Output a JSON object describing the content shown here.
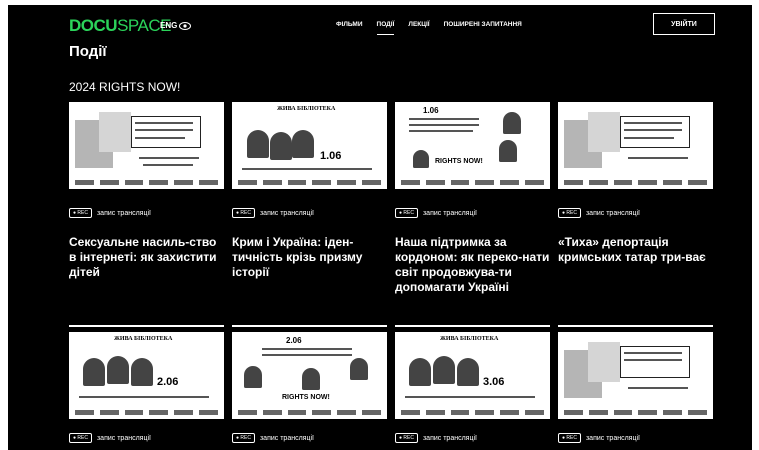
{
  "header": {
    "logo_bold": "DOCU",
    "logo_thin": "SPACE",
    "lang": "ENG",
    "nav": [
      "ФІЛЬМИ",
      "ПОДІЇ",
      "ЛЕКЦІЇ",
      "ПОШИРЕНІ ЗАПИТАННЯ"
    ],
    "login": "УВІЙТИ"
  },
  "page_title": "Події",
  "section_title": "2024 RIGHTS NOW!",
  "rec_badge": "● REC",
  "rec_label": "запис трансляції",
  "cards_row1": [
    {
      "title": "Сексуальне насиль-ство в інтернеті: як захистити дітей"
    },
    {
      "title": "Крим і Україна: іден-тичність крізь призму історії"
    },
    {
      "title": "Наша підтримка за кордоном: як переко-нати світ продовжува-ти допомагати Україні"
    },
    {
      "title": "«Тиха» депортація кримських татар три-ває"
    }
  ],
  "thumbs": {
    "library": "ЖИВА БІБЛІОТЕКА",
    "date1": "1.06",
    "date2": "2.06",
    "date3": "3.06",
    "rights": "RIGHTS NOW!"
  }
}
